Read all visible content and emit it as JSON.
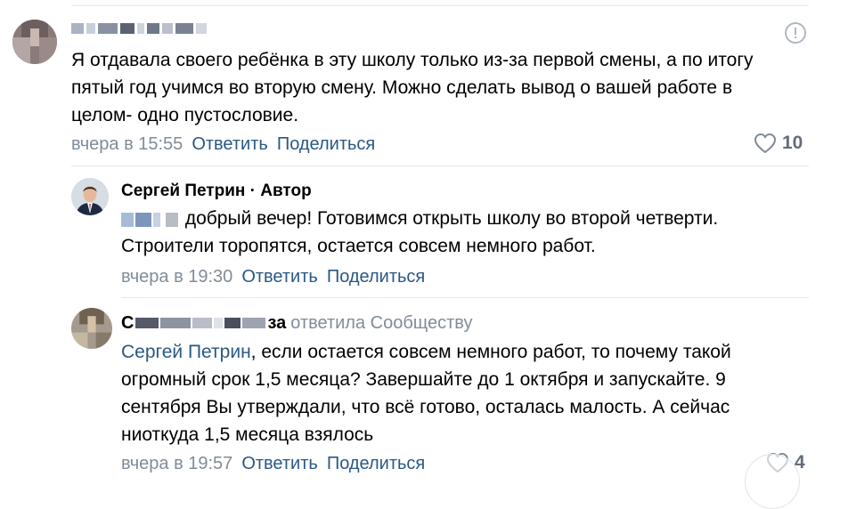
{
  "comments": [
    {
      "text": "Я отдавала своего ребёнка в эту школу только из-за первой смены, а по итогу пятый год учимся во вторую смену. Можно сделать вывод о вашей работе в целом- одно пустословие.",
      "time": "вчера в 15:55",
      "reply_label": "Ответить",
      "share_label": "Поделиться",
      "likes": "10"
    },
    {
      "author": "Сергей Петрин · Автор",
      "text": "добрый вечер! Готовимся открыть школу во второй четверти. Строители торопятся, остается совсем немного работ.",
      "time": "вчера в 19:30",
      "reply_label": "Ответить",
      "share_label": "Поделиться"
    },
    {
      "author_visible_start": "С",
      "author_visible_end": "за",
      "replied_to": "ответила Сообществу",
      "mention": "Сергей Петрин",
      "text": ", если остается совсем немного работ, то почему такой огромный срок 1,5 месяца? Завершайте до 1 октября и запускайте. 9 сентября Вы утверждали, что всё готово, осталась малость. А сейчас ниоткуда 1,5 месяца взялось",
      "time": "вчера в 19:57",
      "reply_label": "Ответить",
      "share_label": "Поделиться",
      "likes": "4"
    }
  ],
  "colors": {
    "link": "#2a5885",
    "meta": "#818c99",
    "divider": "#e7e8ec"
  },
  "icons": [
    "report-icon",
    "heart-icon"
  ]
}
